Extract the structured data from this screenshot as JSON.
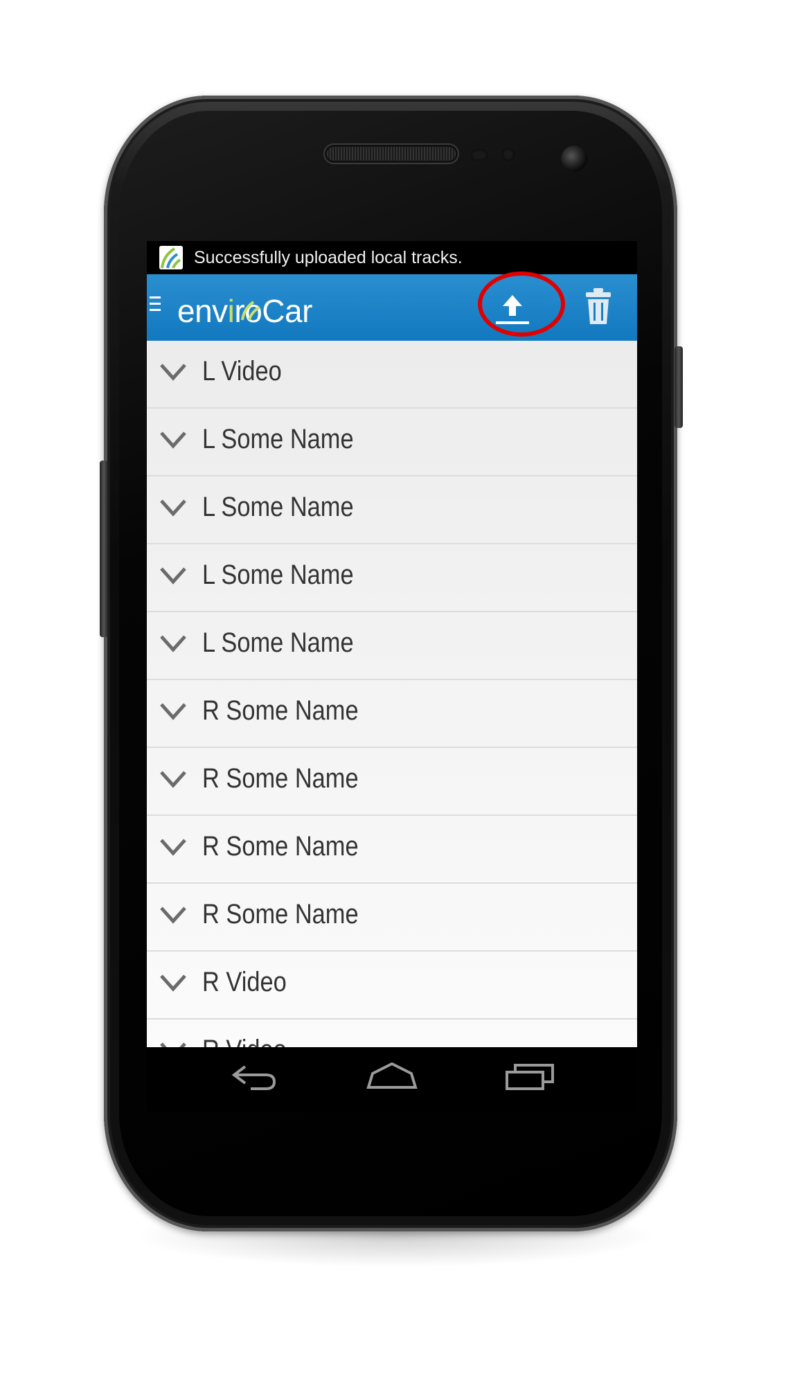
{
  "notification": {
    "text": "Successfully uploaded local tracks.",
    "icon": "envirocar-app-icon"
  },
  "action_bar": {
    "app_name_prefix": "env",
    "app_name_accent": "i",
    "app_name_suffix": "roCar",
    "brand_color": "#1a80c6",
    "logo_accent_color": "#c8e06a",
    "actions": [
      {
        "name": "upload",
        "icon": "upload-icon",
        "highlighted": true
      },
      {
        "name": "delete",
        "icon": "trash-icon",
        "highlighted": false
      }
    ],
    "highlight_color": "#e00000"
  },
  "tracks": [
    {
      "label": "L Video"
    },
    {
      "label": "L Some Name"
    },
    {
      "label": "L Some Name"
    },
    {
      "label": "L Some Name"
    },
    {
      "label": "L Some Name"
    },
    {
      "label": "R Some Name"
    },
    {
      "label": "R Some Name"
    },
    {
      "label": "R Some Name"
    },
    {
      "label": "R Some Name"
    },
    {
      "label": "R Video"
    },
    {
      "label": "R Video"
    }
  ],
  "navigation": [
    {
      "name": "back",
      "icon": "back-icon"
    },
    {
      "name": "home",
      "icon": "home-icon"
    },
    {
      "name": "recents",
      "icon": "recents-icon"
    }
  ]
}
